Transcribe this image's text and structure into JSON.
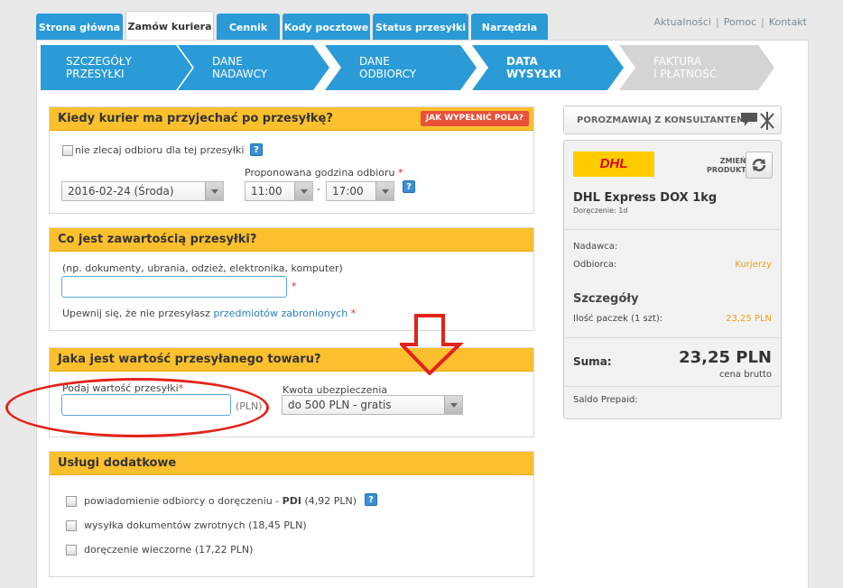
{
  "tabs": [
    "Strona główna",
    "Zamów kuriera",
    "Cennik",
    "Kody pocztowe",
    "Status przesyłki",
    "Narzędzia"
  ],
  "toplinks": [
    "Aktualności",
    "Pomoc",
    "Kontakt"
  ],
  "steps": [
    {
      "line1": "SZCZEGÓŁY",
      "line2": "PRZESYŁKI"
    },
    {
      "line1": "DANE",
      "line2": "NADAWCY"
    },
    {
      "line1": "DANE",
      "line2": "ODBIORCY"
    },
    {
      "line1": "DATA",
      "line2": "WYSYŁKI"
    },
    {
      "line1": "FAKTURA",
      "line2": "I PŁATNOŚĆ"
    }
  ],
  "pickup": {
    "title": "Kiedy kurier ma przyjechać po przesyłkę?",
    "help_button": "JAK WYPEŁNIĆ POLA?",
    "no_pickup_label": "nie zlecaj odbioru dla tej przesyłki",
    "time_label": "Proponowana godzina odbioru",
    "date": "2016-02-24 (Środa)",
    "time_from": "11:00",
    "time_to": "17:00",
    "dash": "-"
  },
  "contents": {
    "title": "Co jest zawartością przesyłki?",
    "hint": "(np. dokumenty, ubrania, odzież, elektronika, komputer)",
    "value": "",
    "warning_prefix": "Upewnij się, że nie przesyłasz",
    "warning_link": "przedmiotów zabronionych"
  },
  "value_section": {
    "title": "Jaka jest wartość przesyłanego towaru?",
    "value_label": "Podaj wartość przesyłki",
    "value": "",
    "unit": "(PLN)",
    "insurance_label": "Kwota ubezpieczenia",
    "insurance_value": "do 500 PLN - gratis"
  },
  "extras": {
    "title": "Usługi dodatkowe",
    "items": [
      {
        "label": "powiadomienie odbiorcy o doręczeniu -",
        "bold": "PDI",
        "price": "(4,92 PLN)"
      },
      {
        "label": "wysyłka dokumentów zwrotnych",
        "bold": "",
        "price": "(18,45 PLN)"
      },
      {
        "label": "doręczenie wieczorne",
        "bold": "",
        "price": "(17,22 PLN)"
      }
    ]
  },
  "sidebar": {
    "consult_button": "POROZMAWIAJ Z KONSULTANTEM",
    "carrier_logo": "DHL",
    "change_product_line1": "ZMIEŃ",
    "change_product_line2": "PRODUKT",
    "product_name": "DHL Express DOX 1kg",
    "delivery": "Doręczenie: 1d",
    "sender_label": "Nadawca:",
    "recipient_label": "Odbiorca:",
    "recipient_value": "Kurjerzy",
    "details_title": "Szczegóły",
    "packages_label": "Ilość paczek (1 szt):",
    "packages_value": "23,25 PLN",
    "sum_label": "Suma:",
    "sum_value": "23,25 PLN",
    "sum_note": "cena brutto",
    "prepaid_label": "Saldo Prepaid:"
  },
  "colors": {
    "tab_blue": "#2a9bd6",
    "step_blue": "#2a9bd6",
    "step_grey": "#d4d4d4",
    "panel_yellow": "#fcc02e",
    "annotation_red": "#e2231a"
  }
}
